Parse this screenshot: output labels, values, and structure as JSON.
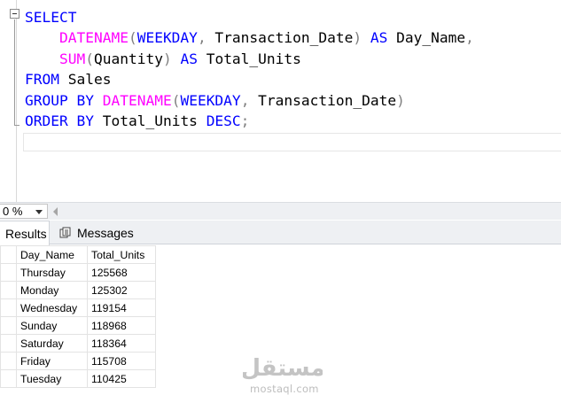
{
  "editor": {
    "lines": [
      [
        {
          "t": "SELECT",
          "c": "kw"
        }
      ],
      [
        {
          "t": "    "
        },
        {
          "t": "DATENAME",
          "c": "fn"
        },
        {
          "t": "(",
          "c": "op"
        },
        {
          "t": "WEEKDAY",
          "c": "kw"
        },
        {
          "t": ",",
          "c": "op"
        },
        {
          "t": " Transaction_Date"
        },
        {
          "t": ")",
          "c": "op"
        },
        {
          "t": " "
        },
        {
          "t": "AS",
          "c": "kw"
        },
        {
          "t": " Day_Name"
        },
        {
          "t": ",",
          "c": "op"
        }
      ],
      [
        {
          "t": "    "
        },
        {
          "t": "SUM",
          "c": "fn"
        },
        {
          "t": "(",
          "c": "op"
        },
        {
          "t": "Quantity"
        },
        {
          "t": ")",
          "c": "op"
        },
        {
          "t": " "
        },
        {
          "t": "AS",
          "c": "kw"
        },
        {
          "t": " Total_Units"
        }
      ],
      [
        {
          "t": "FROM",
          "c": "kw"
        },
        {
          "t": " Sales"
        }
      ],
      [
        {
          "t": "GROUP",
          "c": "kw"
        },
        {
          "t": " "
        },
        {
          "t": "BY",
          "c": "kw"
        },
        {
          "t": " "
        },
        {
          "t": "DATENAME",
          "c": "fn"
        },
        {
          "t": "(",
          "c": "op"
        },
        {
          "t": "WEEKDAY",
          "c": "kw"
        },
        {
          "t": ",",
          "c": "op"
        },
        {
          "t": " Transaction_Date"
        },
        {
          "t": ")",
          "c": "op"
        }
      ],
      [
        {
          "t": "ORDER",
          "c": "kw"
        },
        {
          "t": " "
        },
        {
          "t": "BY",
          "c": "kw"
        },
        {
          "t": " Total_Units "
        },
        {
          "t": "DESC",
          "c": "kw"
        },
        {
          "t": ";",
          "c": "op"
        }
      ]
    ],
    "colors": {
      "keyword": "#0000ff",
      "function": "#ff00ff",
      "operator": "#808080"
    }
  },
  "zoom": {
    "value": "0 %"
  },
  "tabs": {
    "results": "Results",
    "messages": "Messages"
  },
  "grid": {
    "columns": [
      "Day_Name",
      "Total_Units"
    ],
    "rows": [
      [
        "Thursday",
        "125568"
      ],
      [
        "Monday",
        "125302"
      ],
      [
        "Wednesday",
        "119154"
      ],
      [
        "Sunday",
        "118968"
      ],
      [
        "Saturday",
        "118364"
      ],
      [
        "Friday",
        "115708"
      ],
      [
        "Tuesday",
        "110425"
      ]
    ]
  },
  "watermark": {
    "logo": "مستقل",
    "site": "mostaql.com"
  }
}
